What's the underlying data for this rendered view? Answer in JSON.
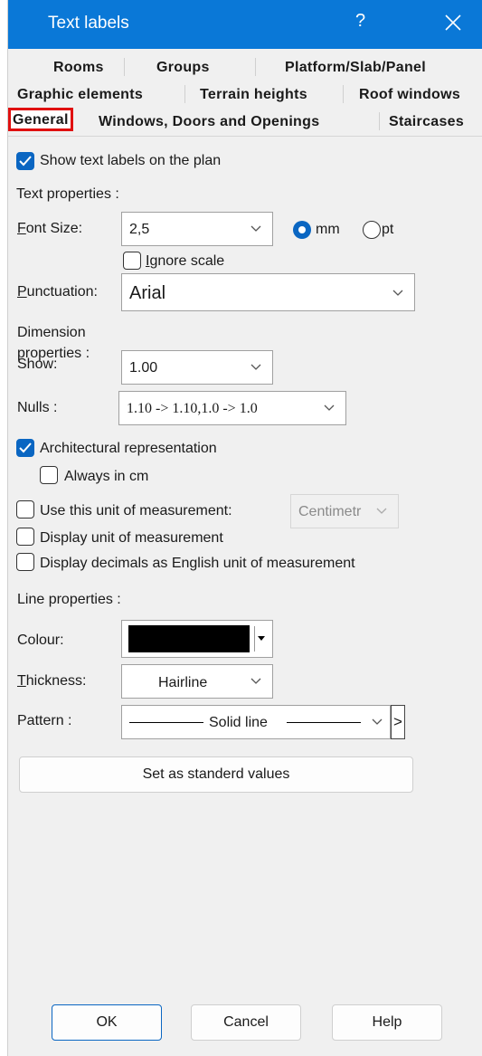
{
  "window": {
    "title": "Text labels",
    "help_symbol": "?"
  },
  "tabs": {
    "row1": [
      "Rooms",
      "Groups",
      "Platform/Slab/Panel"
    ],
    "row2": [
      "Graphic elements",
      "Terrain heights",
      "Roof windows"
    ],
    "row3": [
      "General",
      "Windows, Doors and Openings",
      "Staircases"
    ],
    "active": "General"
  },
  "general": {
    "show_labels": {
      "label": "Show text labels on the plan",
      "checked": true
    },
    "text_properties_heading": "Text properties :",
    "font_size": {
      "label": "Font Size:",
      "value": "2,5"
    },
    "unit_radio": {
      "mm": "mm",
      "pt": "pt",
      "selected": "mm"
    },
    "ignore_scale": {
      "label": "Ignore scale",
      "checked": false
    },
    "punctuation": {
      "label": "Punctuation:",
      "value": "Arial"
    },
    "dimension_heading_line1": "Dimension",
    "dimension_heading_line2": "properties :",
    "show": {
      "label": "Show:",
      "value": "1.00"
    },
    "nulls": {
      "label": "Nulls :",
      "value": "1.10 -> 1.10,1.0 -> 1.0"
    },
    "architectural": {
      "label": "Architectural representation",
      "checked": true
    },
    "always_cm": {
      "label": "Always in cm",
      "checked": false
    },
    "use_unit": {
      "label": "Use this unit of measurement:",
      "checked": false,
      "value": "Centimetr"
    },
    "display_unit": {
      "label": "Display unit of measurement",
      "checked": false
    },
    "display_decimals": {
      "label": "Display decimals as English unit of measurement",
      "checked": false
    },
    "line_properties_heading": "Line properties :",
    "colour": {
      "label": "Colour:",
      "value_hex": "#000000"
    },
    "thickness": {
      "label": "Thickness:",
      "value": "Hairline"
    },
    "pattern": {
      "label": "Pattern :",
      "value": "Solid line",
      "more_symbol": ">"
    },
    "set_default_button": "Set as standerd values"
  },
  "footer": {
    "ok": "OK",
    "cancel": "Cancel",
    "help": "Help"
  },
  "colors": {
    "titlebar": "#0a78d7",
    "checkbox_checked": "#0a66c2",
    "active_tab_outline": "#e01010"
  }
}
